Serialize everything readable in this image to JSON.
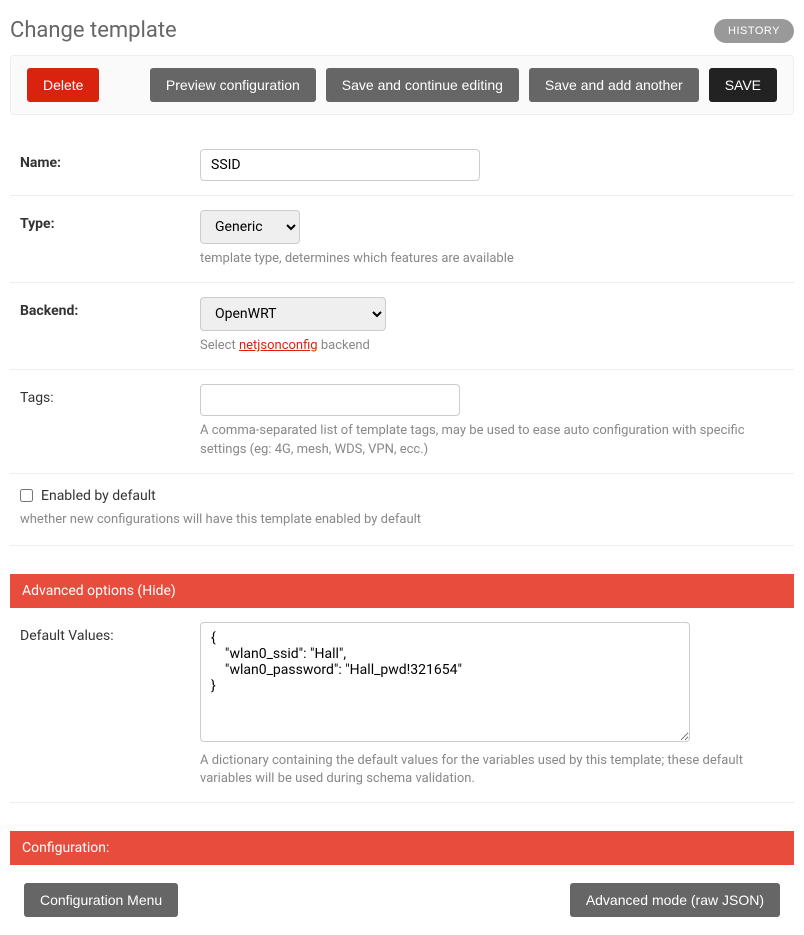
{
  "header": {
    "title": "Change template",
    "history_label": "HISTORY"
  },
  "actions": {
    "delete": "Delete",
    "preview": "Preview configuration",
    "save_continue": "Save and continue editing",
    "save_add": "Save and add another",
    "save": "SAVE"
  },
  "form": {
    "name": {
      "label": "Name:",
      "value": "SSID"
    },
    "type": {
      "label": "Type:",
      "value": "Generic",
      "options": [
        "Generic"
      ],
      "help": "template type, determines which features are available"
    },
    "backend": {
      "label": "Backend:",
      "value": "OpenWRT",
      "options": [
        "OpenWRT"
      ],
      "help_pre": "Select ",
      "help_link": "netjsonconfig",
      "help_post": " backend"
    },
    "tags": {
      "label": "Tags:",
      "value": "",
      "help": "A comma-separated list of template tags, may be used to ease auto configuration with specific settings (eg: 4G, mesh, WDS, VPN, ecc.)"
    },
    "enabled": {
      "label": "Enabled by default",
      "checked": false,
      "help": "whether new configurations will have this template enabled by default"
    }
  },
  "advanced": {
    "title": "Advanced options ",
    "toggle": "(Hide)",
    "default_values": {
      "label": "Default Values:",
      "value": "{\n    \"wlan0_ssid\": \"Hall\",\n    \"wlan0_password\": \"Hall_pwd!321654\"\n}",
      "help": "A dictionary containing the default values for the variables used by this template; these default variables will be used during schema validation."
    }
  },
  "configuration": {
    "title": "Configuration:",
    "menu_btn": "Configuration Menu",
    "advanced_btn": "Advanced mode (raw JSON)"
  }
}
